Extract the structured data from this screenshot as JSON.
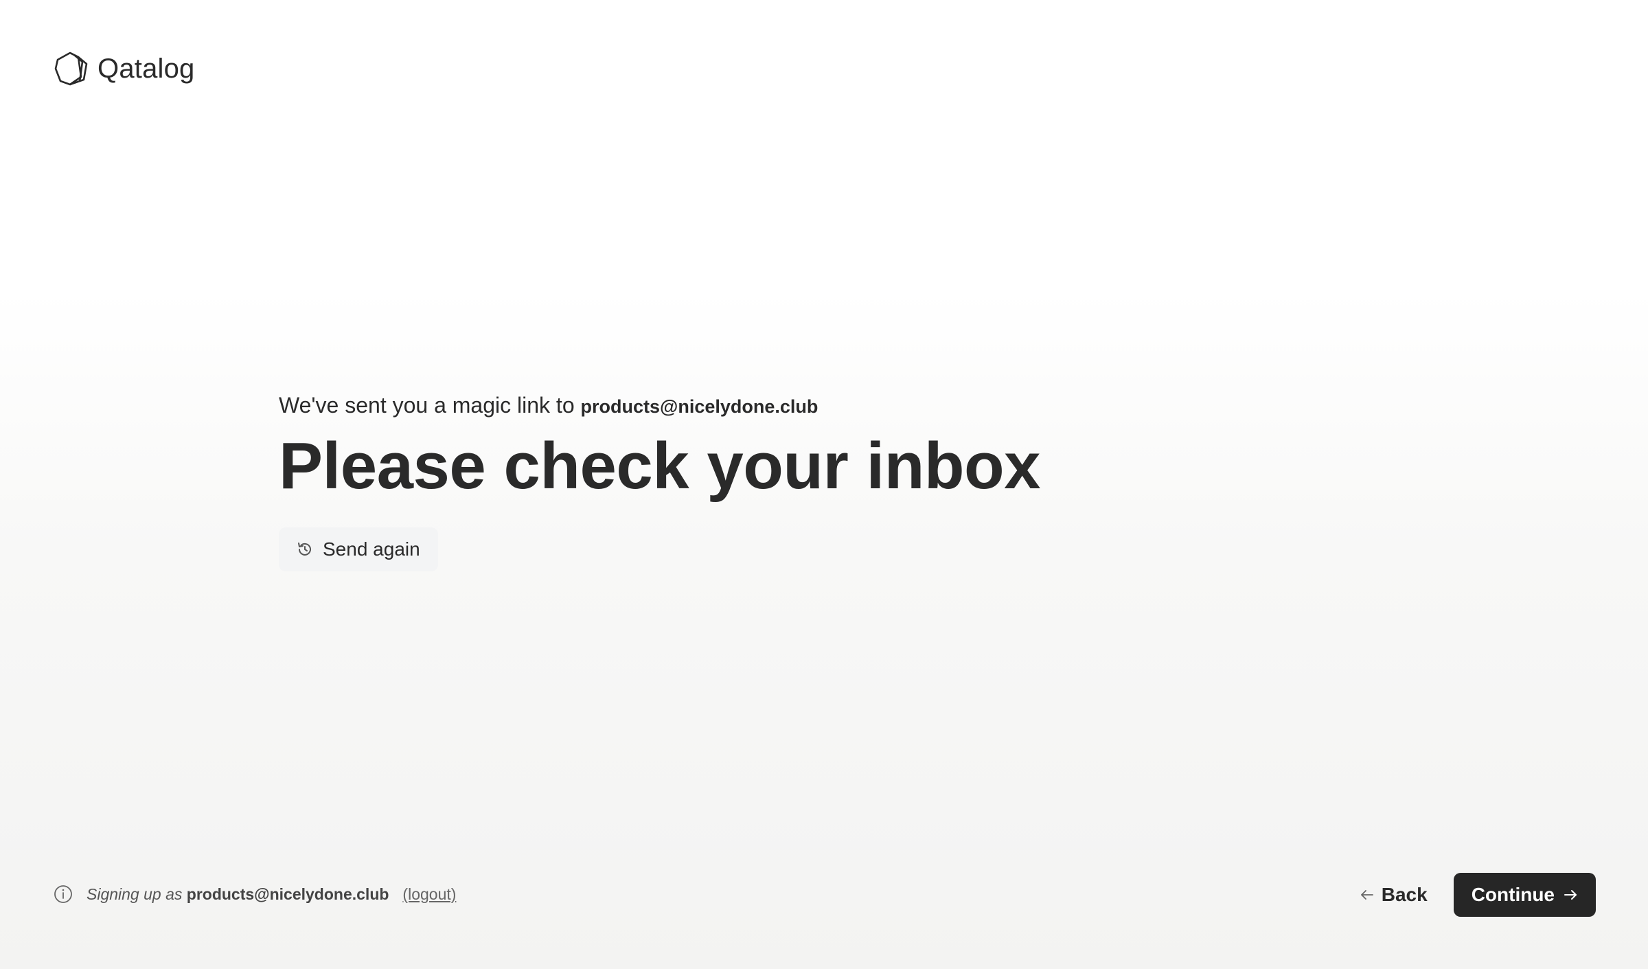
{
  "brand": {
    "name": "Qatalog",
    "icon": "qatalog-logo-icon"
  },
  "main": {
    "subtitle_prefix": "We've sent you a magic link to",
    "subtitle_email": "products@nicelydone.club",
    "headline": "Please check your inbox",
    "send_again_label": "Send again",
    "send_again_icon": "history-icon"
  },
  "footer": {
    "info_icon": "info-icon",
    "signing_text": "Signing up as",
    "user_email": "products@nicelydone.club",
    "logout_label": "(logout)",
    "back_label": "Back",
    "continue_label": "Continue"
  },
  "colors": {
    "text": "#2a2a2a",
    "button_dark": "#262626",
    "button_light": "#f3f4f5"
  }
}
